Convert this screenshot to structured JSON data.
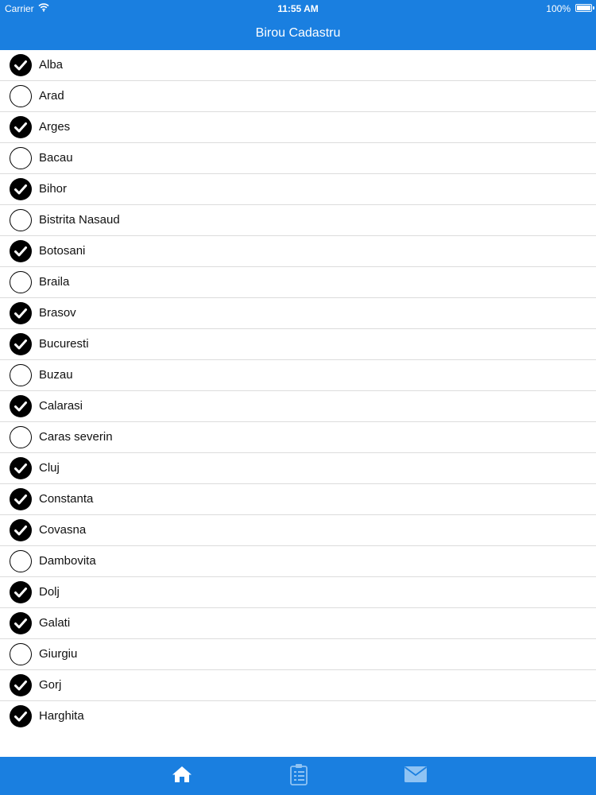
{
  "status_bar": {
    "carrier": "Carrier",
    "time": "11:55 AM",
    "battery": "100%"
  },
  "header": {
    "title": "Birou Cadastru"
  },
  "counties": [
    {
      "name": "Alba",
      "checked": true
    },
    {
      "name": "Arad",
      "checked": false
    },
    {
      "name": "Arges",
      "checked": true
    },
    {
      "name": "Bacau",
      "checked": false
    },
    {
      "name": "Bihor",
      "checked": true
    },
    {
      "name": "Bistrita Nasaud",
      "checked": false
    },
    {
      "name": "Botosani",
      "checked": true
    },
    {
      "name": "Braila",
      "checked": false
    },
    {
      "name": "Brasov",
      "checked": true
    },
    {
      "name": "Bucuresti",
      "checked": true
    },
    {
      "name": "Buzau",
      "checked": false
    },
    {
      "name": "Calarasi",
      "checked": true
    },
    {
      "name": "Caras severin",
      "checked": false
    },
    {
      "name": "Cluj",
      "checked": true
    },
    {
      "name": "Constanta",
      "checked": true
    },
    {
      "name": "Covasna",
      "checked": true
    },
    {
      "name": "Dambovita",
      "checked": false
    },
    {
      "name": "Dolj",
      "checked": true
    },
    {
      "name": "Galati",
      "checked": true
    },
    {
      "name": "Giurgiu",
      "checked": false
    },
    {
      "name": "Gorj",
      "checked": true
    },
    {
      "name": "Harghita",
      "checked": true
    }
  ],
  "tabs": [
    {
      "icon": "home-icon",
      "selected": true
    },
    {
      "icon": "clipboard-icon",
      "selected": false
    },
    {
      "icon": "mail-icon",
      "selected": false
    }
  ],
  "colors": {
    "accent": "#1a7fe0",
    "check_fill": "#000000",
    "divider": "#dcdcdc",
    "tab_selected": "#ffffff",
    "tab_unselected": "#8fc3f3"
  }
}
